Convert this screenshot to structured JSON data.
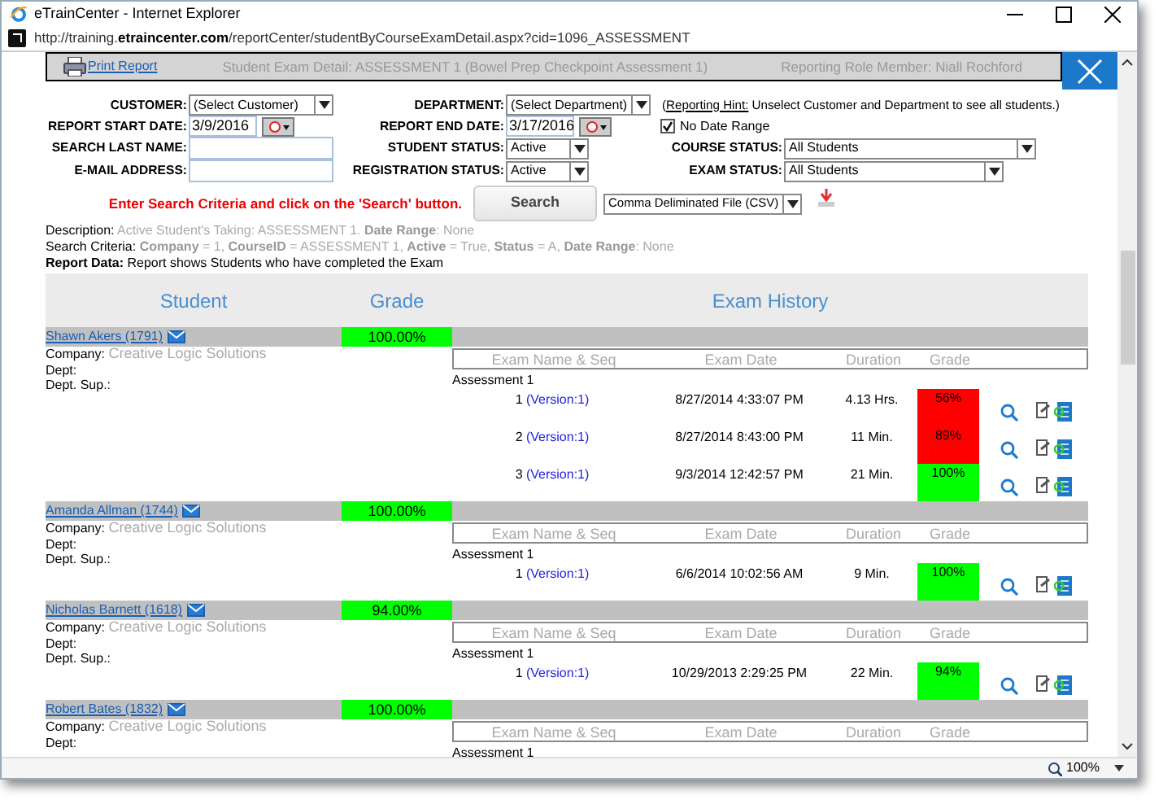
{
  "window": {
    "title": "eTrainCenter - Internet Explorer",
    "url": "http://training.**etraincenter.com**/reportCenter/studentByCourseExamDetail.aspx?cid=1096_ASSESSMENT"
  },
  "header_bar": {
    "print_label": "Print Report",
    "title": "Student Exam Detail: ASSESSMENT 1 (Bowel Prep Checkpoint Assessment 1)",
    "role": "Reporting Role Member: Niall Rochford"
  },
  "form_rows": [
    [
      {
        "kind": "select",
        "label": "CUSTOMER:",
        "value": "(Select Customer)"
      },
      {
        "kind": "select",
        "label": "DEPARTMENT:",
        "value": "(Select Department)"
      },
      {
        "kind": "hint",
        "open": "(",
        "link": "Reporting Hint:",
        "text": "Unselect Customer and Department to see all students.)"
      }
    ],
    [
      {
        "kind": "date",
        "label": "REPORT START DATE:",
        "value": "3/9/2016"
      },
      {
        "kind": "date",
        "label": "REPORT END DATE:",
        "value": "3/17/2016"
      },
      {
        "kind": "checkbox",
        "label": "No Date Range",
        "checked": true
      }
    ],
    [
      {
        "kind": "text",
        "label": "SEARCH LAST NAME:"
      },
      {
        "kind": "select",
        "label": "STUDENT STATUS:",
        "value": "Active"
      },
      {
        "kind": "select",
        "label": "COURSE STATUS:",
        "value": "All Students"
      }
    ],
    [
      {
        "kind": "text",
        "label": "E-MAIL ADDRESS:"
      },
      {
        "kind": "select",
        "label": "REGISTRATION STATUS:",
        "value": "Active"
      },
      {
        "kind": "select",
        "label": "EXAM STATUS:",
        "value": "All Students"
      }
    ]
  ],
  "search": {
    "instruction": "Enter Search Criteria and click on the 'Search' button.",
    "button": "Search",
    "export": "Comma Deliminated File (CSV)"
  },
  "info": [
    {
      "label": "Description:",
      "text": "Active Student's Taking: ASSESSMENT 1. **Date Range**: None"
    },
    {
      "label": "Search Criteria:",
      "text": "**Company** = 1, **CourseID** = ASSESSMENT 1, **Active** = True, **Status** = A, **Date Range**: None"
    },
    {
      "label": "Report Data:",
      "text": "Report shows Students who have completed the Exam",
      "bold_label": true
    }
  ],
  "table": {
    "columns": [
      "Student",
      "Grade",
      "Exam History"
    ],
    "students": [
      {
        "name": "Shawn Akers (1791)",
        "grade": "100.00%",
        "color": "#00ff00",
        "details": [
          "Company:",
          "Dept:",
          "Dept. Sup.:"
        ],
        "company": "Creative Logic Solutions",
        "exam_columns": [
          "Exam Name & Seq",
          "Exam Date",
          "Duration",
          "Grade"
        ],
        "exam": "Assessment 1",
        "attempts": [
          {
            "seq": "1",
            "version": "(Version:1)",
            "date": "8/27/2014 4:33:07 PM",
            "duration": "4.13 Hrs.",
            "grade": "56%",
            "color": "#ff0000"
          },
          {
            "seq": "2",
            "version": "(Version:1)",
            "date": "8/27/2014 8:43:00 PM",
            "duration": "11 Min.",
            "grade": "89%",
            "color": "#ff0000"
          },
          {
            "seq": "3",
            "version": "(Version:1)",
            "date": "9/3/2014 12:42:57 PM",
            "duration": "21 Min.",
            "grade": "100%",
            "color": "#00ff00"
          }
        ]
      },
      {
        "name": "Amanda Allman (1744)",
        "grade": "100.00%",
        "color": "#00ff00",
        "details": [
          "Company:",
          "Dept:",
          "Dept. Sup.:"
        ],
        "company": "Creative Logic Solutions",
        "exam_columns": [
          "Exam Name & Seq",
          "Exam Date",
          "Duration",
          "Grade"
        ],
        "exam": "Assessment 1",
        "attempts": [
          {
            "seq": "1",
            "version": "(Version:1)",
            "date": "6/6/2014 10:02:56 AM",
            "duration": "9 Min.",
            "grade": "100%",
            "color": "#00ff00"
          }
        ]
      },
      {
        "name": "Nicholas Barnett (1618)",
        "grade": "94.00%",
        "color": "#00ff00",
        "details": [
          "Company:",
          "Dept:",
          "Dept. Sup.:"
        ],
        "company": "Creative Logic Solutions",
        "exam_columns": [
          "Exam Name & Seq",
          "Exam Date",
          "Duration",
          "Grade"
        ],
        "exam": "Assessment 1",
        "attempts": [
          {
            "seq": "1",
            "version": "(Version:1)",
            "date": "10/29/2013 2:29:25 PM",
            "duration": "22 Min.",
            "grade": "94%",
            "color": "#00ff00"
          }
        ]
      },
      {
        "name": "Robert Bates (1832)",
        "grade": "100.00%",
        "color": "#00ff00",
        "details": [
          "Company:",
          "Dept:"
        ],
        "company": "Creative Logic Solutions",
        "exam_columns": [
          "Exam Name & Seq",
          "Exam Date",
          "Duration",
          "Grade"
        ],
        "exam": "Assessment 1"
      }
    ]
  },
  "status_bar": {
    "zoom": "100%"
  }
}
